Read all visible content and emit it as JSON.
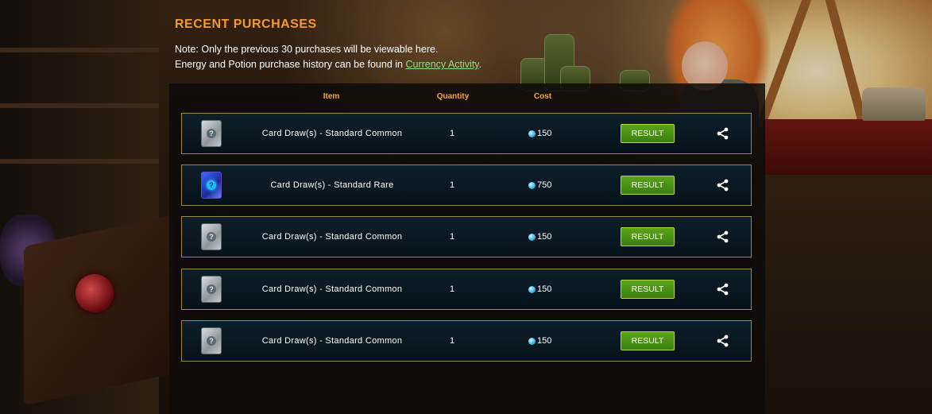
{
  "heading": "RECENT PURCHASES",
  "note": {
    "line1": "Note: Only the previous 30 purchases will be viewable here.",
    "line2_prefix": "Energy and Potion purchase history can be found in ",
    "link": "Currency Activity",
    "line2_suffix": "."
  },
  "table": {
    "headers": {
      "item": "Item",
      "quantity": "Quantity",
      "cost": "Cost"
    },
    "rows": [
      {
        "item": "Card Draw(s) - Standard Common",
        "rarity": "common",
        "quantity": "1",
        "cost": "150",
        "action": "RESULT",
        "icon": "card-common-icon"
      },
      {
        "item": "Card Draw(s) - Standard Rare",
        "rarity": "rare",
        "quantity": "1",
        "cost": "750",
        "action": "RESULT",
        "icon": "card-rare-icon"
      },
      {
        "item": "Card Draw(s) - Standard Common",
        "rarity": "common",
        "quantity": "1",
        "cost": "150",
        "action": "RESULT",
        "icon": "card-common-icon"
      },
      {
        "item": "Card Draw(s) - Standard Common",
        "rarity": "common",
        "quantity": "1",
        "cost": "150",
        "action": "RESULT",
        "icon": "card-common-icon"
      },
      {
        "item": "Card Draw(s) - Standard Common",
        "rarity": "common",
        "quantity": "1",
        "cost": "150",
        "action": "RESULT",
        "icon": "card-common-icon"
      }
    ]
  },
  "icons": {
    "currency": "gem-icon",
    "share": "share-icon",
    "card_mark": "?"
  },
  "colors": {
    "heading": "#f59a2e",
    "link": "#8fe27a",
    "button": "#4a921a",
    "row_border": "#a08347"
  }
}
